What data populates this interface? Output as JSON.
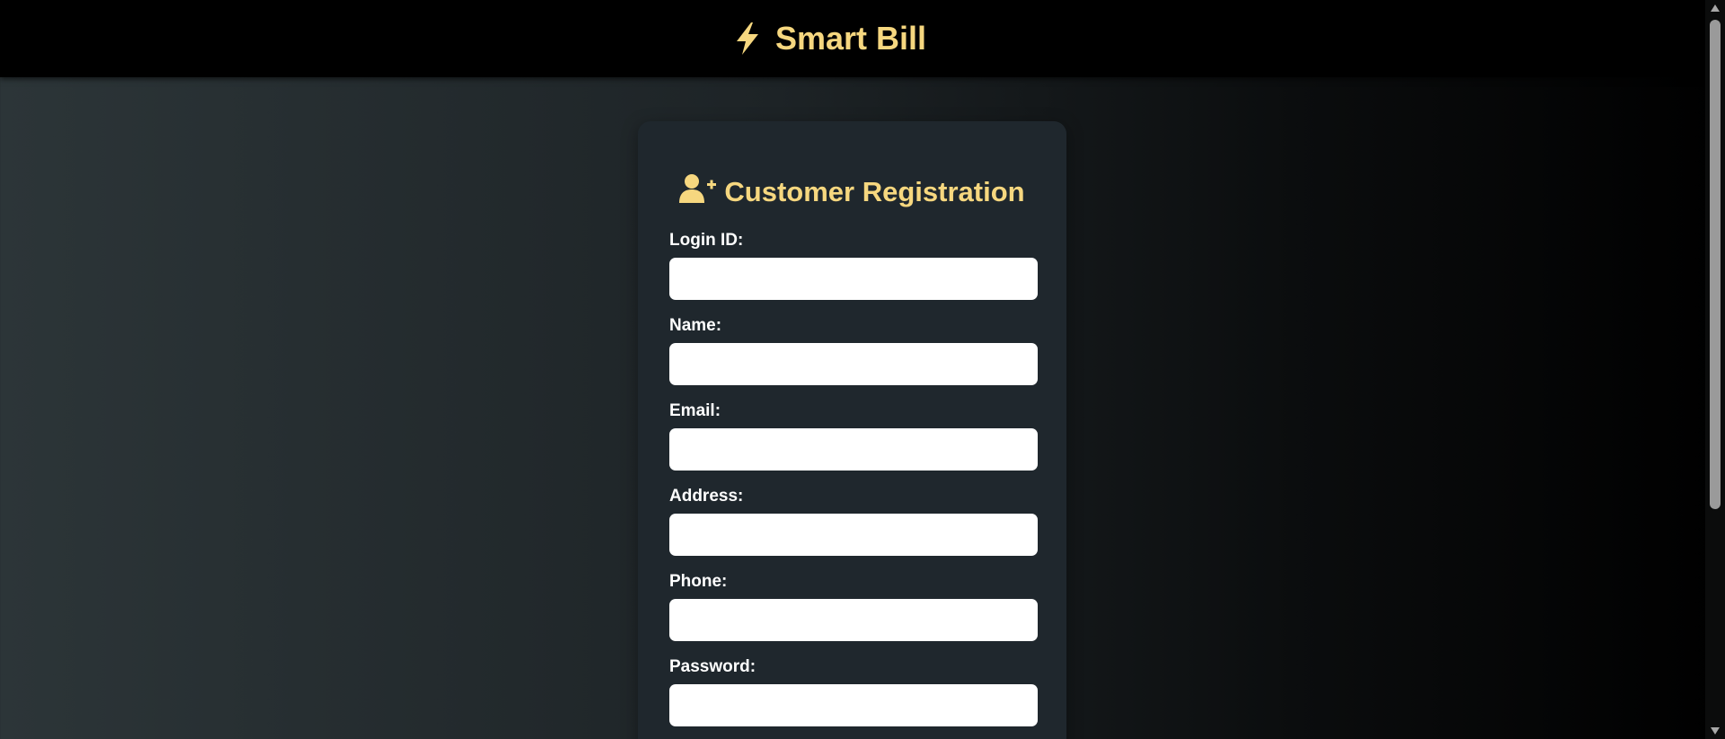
{
  "header": {
    "brand_icon": "lightning-bolt-icon",
    "brand_name": "Smart Bill"
  },
  "form": {
    "title_icon": "user-plus-icon",
    "title": "Customer Registration",
    "fields": [
      {
        "label": "Login ID:",
        "value": "",
        "placeholder": ""
      },
      {
        "label": "Name:",
        "value": "",
        "placeholder": ""
      },
      {
        "label": "Email:",
        "value": "",
        "placeholder": ""
      },
      {
        "label": "Address:",
        "value": "",
        "placeholder": ""
      },
      {
        "label": "Phone:",
        "value": "",
        "placeholder": ""
      },
      {
        "label": "Password:",
        "value": "",
        "placeholder": ""
      }
    ]
  },
  "colors": {
    "accent": "#f6d77f",
    "header_bg": "#000000",
    "card_bg": "#1f272d",
    "input_bg": "#ffffff",
    "label_text": "#ffffff"
  }
}
